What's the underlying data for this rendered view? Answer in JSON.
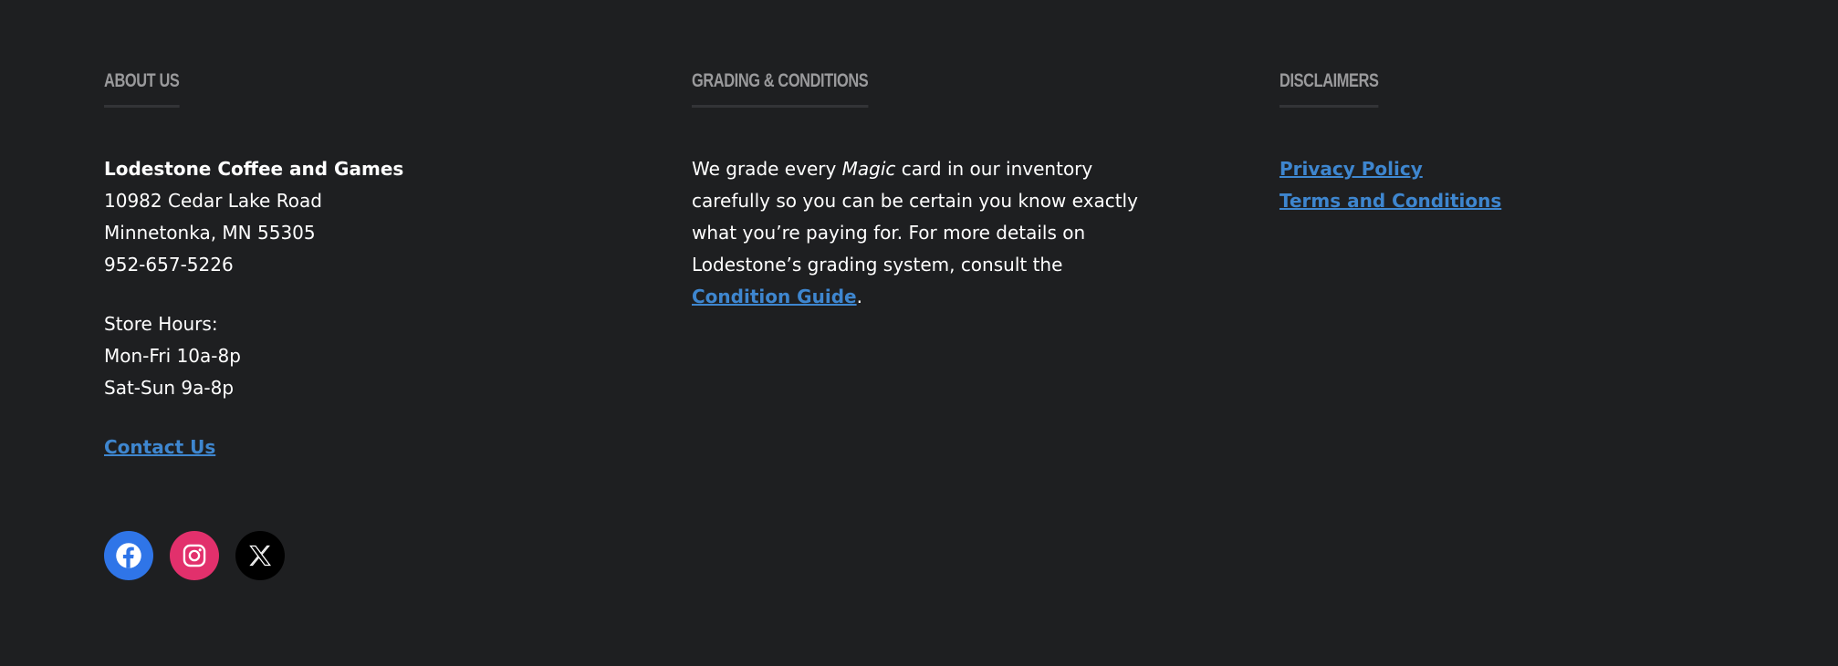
{
  "about": {
    "heading": "About Us",
    "store_name": "Lodestone Coffee and Games",
    "address_line1": "10982 Cedar Lake Road",
    "address_line2": "Minnetonka, MN 55305",
    "phone": "952-657-5226",
    "hours_label": "Store Hours:",
    "hours_weekday": "Mon-Fri 10a-8p",
    "hours_weekend": "Sat-Sun 9a-8p",
    "contact_link": "Contact Us"
  },
  "grading": {
    "heading": "Grading & Conditions",
    "text_before": "We grade every ",
    "text_em": "Magic",
    "text_after": " card in our inventory carefully so you can be certain you know exactly what you’re paying for. For more details on Lodestone’s grading system, consult the ",
    "link": "Condition Guide",
    "text_end": "."
  },
  "disclaimers": {
    "heading": "Disclaimers",
    "links": [
      "Privacy Policy",
      "Terms and Conditions"
    ]
  },
  "social": {
    "icons": [
      "facebook-icon",
      "instagram-icon",
      "x-icon"
    ],
    "colors": {
      "facebook": "#2f75e8",
      "instagram": "#e2306c",
      "x": "#000000"
    }
  },
  "colors": {
    "background": "#1e1f21",
    "heading": "#9a9a9c",
    "link": "#3e86cf",
    "text": "#ffffff"
  }
}
